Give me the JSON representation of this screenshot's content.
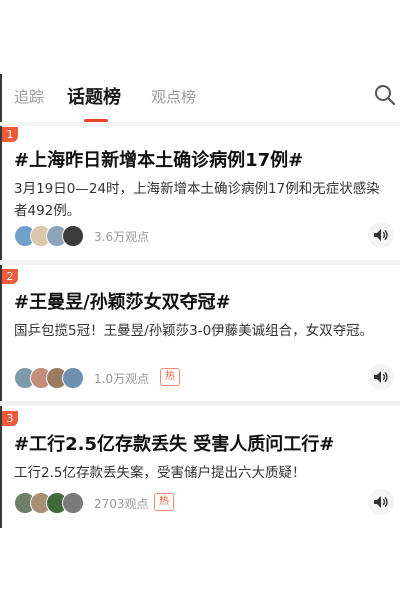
{
  "tabs": [
    {
      "label": "追踪"
    },
    {
      "label": "话题榜"
    },
    {
      "label": "观点榜"
    }
  ],
  "items": [
    {
      "rank": "1",
      "title": "#上海昨日新增本土确诊病例17例#",
      "summary": "3月19日0—24时，上海新增本土确诊病例17例和无症状感染者492例。",
      "views": "3.6万观点",
      "hot": ""
    },
    {
      "rank": "2",
      "title": "#王曼昱/孙颖莎女双夺冠#",
      "summary": "国乒包揽5冠！王曼昱/孙颖莎3-0伊藤美诚组合，女双夺冠。",
      "views": "1.0万观点",
      "hot": "热"
    },
    {
      "rank": "3",
      "title": "#工行2.5亿存款丢失 受害人质问工行#",
      "summary": "工行2.5亿存款丢失案，受害储户提出六大质疑！",
      "views": "2703观点",
      "hot": "热"
    }
  ],
  "colors": {
    "accent": "#e2432a",
    "rank_badge": "#ef5a3b",
    "muted_text": "#999999"
  },
  "icons": [
    "search-icon",
    "speaker-icon",
    "avatar"
  ]
}
